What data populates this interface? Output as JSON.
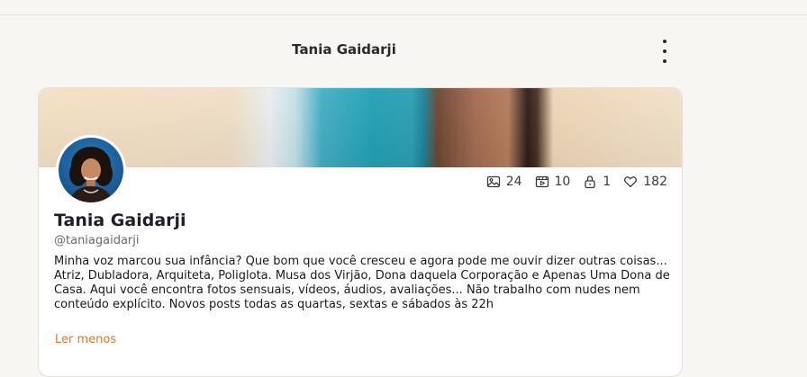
{
  "header": {
    "title": "Tania Gaidarji",
    "menu_icon": "more-vertical-icon"
  },
  "profile": {
    "name": "Tania Gaidarji",
    "handle": "@taniagaidarji",
    "bio": "Minha voz marcou sua infância? Que bom que você cresceu e agora pode me ouvir dizer outras coisas... Atriz, Dubladora, Arquiteta, Poliglota. Musa dos Virjão, Dona daquela Corporação e Apenas Uma Dona de Casa. Aqui você encontra fotos sensuais, vídeos, áudios, avaliações... Não trabalho com nudes nem conteúdo explícito. Novos posts todas as quartas, sextas e sábados às 22h",
    "read_less_label": "Ler menos"
  },
  "stats": {
    "photos": "24",
    "videos": "10",
    "locked": "1",
    "likes": "182"
  },
  "colors": {
    "accent": "#e0782a",
    "background": "#f8f6f2"
  }
}
